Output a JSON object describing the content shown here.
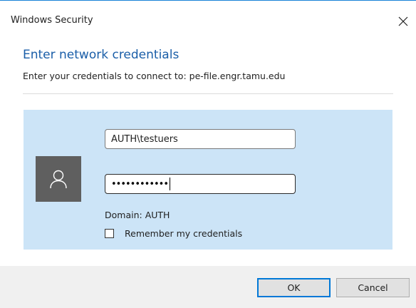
{
  "window": {
    "title": "Windows Security"
  },
  "dialog": {
    "heading": "Enter network credentials",
    "subtext": "Enter your credentials to connect to: pe-file.engr.tamu.edu"
  },
  "credentials": {
    "username_value": "AUTH\\testuers",
    "password_mask": "••••••••••••",
    "domain_label": "Domain: AUTH",
    "remember_label": "Remember my credentials",
    "remember_checked": false
  },
  "buttons": {
    "ok_label": "OK",
    "cancel_label": "Cancel"
  },
  "icons": {
    "close": "close-icon",
    "user": "user-icon"
  },
  "colors": {
    "accent": "#0078d7",
    "heading": "#1a5ea8",
    "panel_background": "#cce4f7",
    "avatar_background": "#5f5f5f",
    "footer_background": "#f0f0f0"
  }
}
